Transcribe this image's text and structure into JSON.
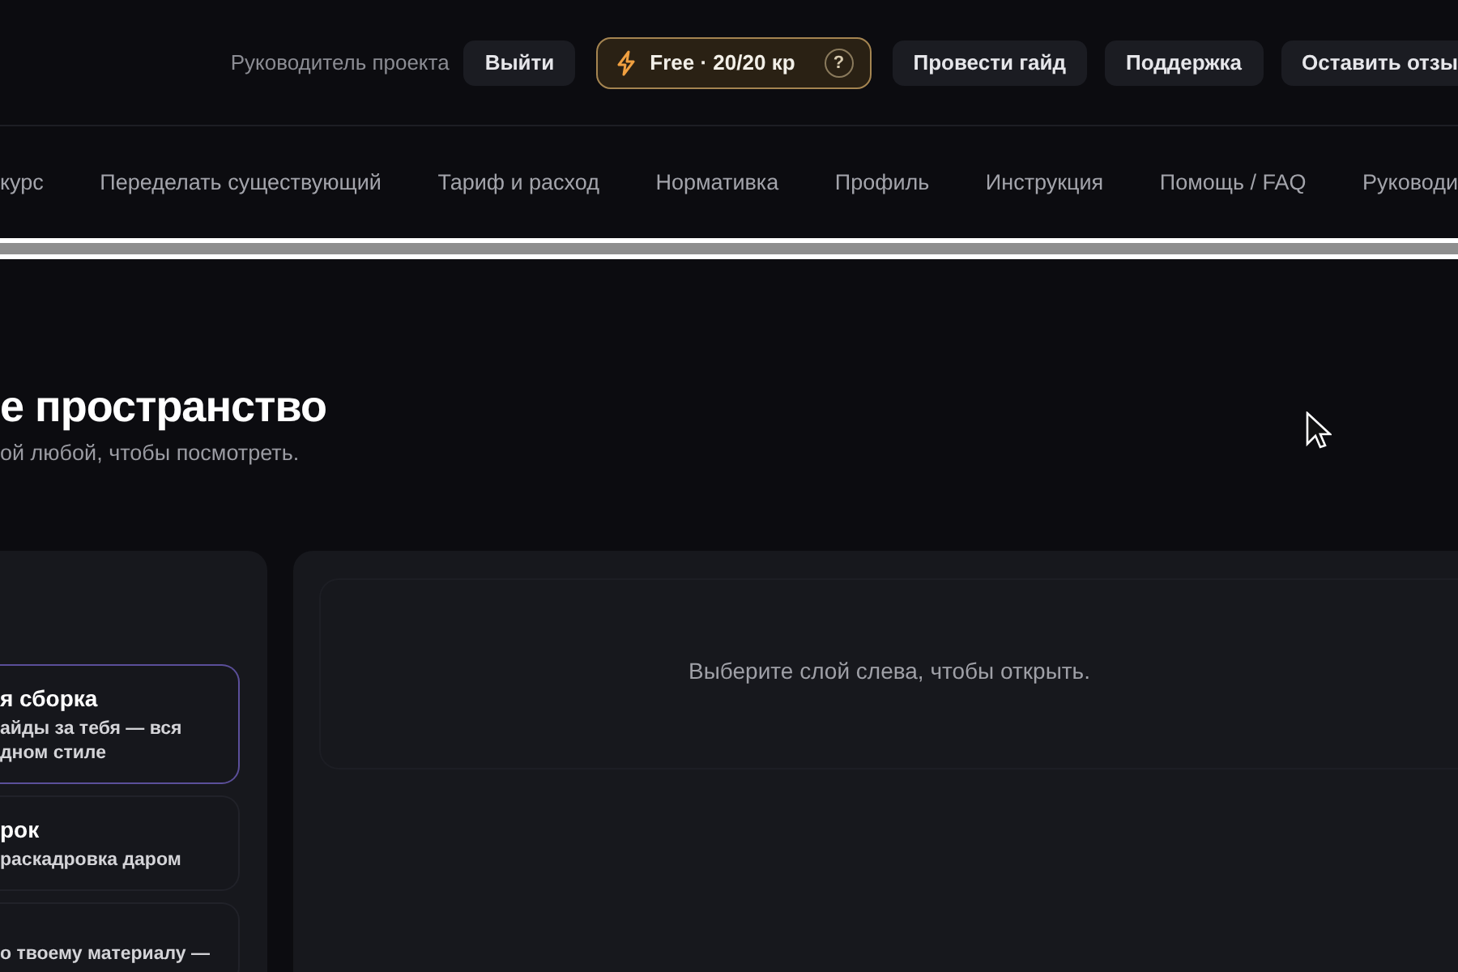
{
  "header": {
    "role_label": "Руководитель проекта",
    "logout": "Выйти",
    "plan": {
      "label": "Free · 20/20 кр",
      "help": "?"
    },
    "buttons": [
      "Провести гайд",
      "Поддержка",
      "Оставить отзы"
    ]
  },
  "nav": [
    {
      "label": "курс",
      "selected": false
    },
    {
      "label": "Переделать существующий",
      "selected": false
    },
    {
      "label": "Тариф и расход",
      "selected": false
    },
    {
      "label": "Нормативка",
      "selected": false
    },
    {
      "label": "Профиль",
      "selected": false
    },
    {
      "label": "Инструкция",
      "selected": false
    },
    {
      "label": "Помощь / FAQ",
      "selected": false
    },
    {
      "label": "Руководи",
      "selected": false
    }
  ],
  "page": {
    "title": "е пространство",
    "subtitle": "ой любой, чтобы посмотреть."
  },
  "layers": [
    {
      "title": "я сборка",
      "description": "айды за тебя — вся\nдном стиле",
      "selected": true
    },
    {
      "title": "рок",
      "description": "раскадровка даром",
      "selected": false
    },
    {
      "description": "о твоему материалу —",
      "selected": false
    }
  ],
  "viewer": {
    "empty_message": "Выберите слой слева, чтобы открыть."
  }
}
